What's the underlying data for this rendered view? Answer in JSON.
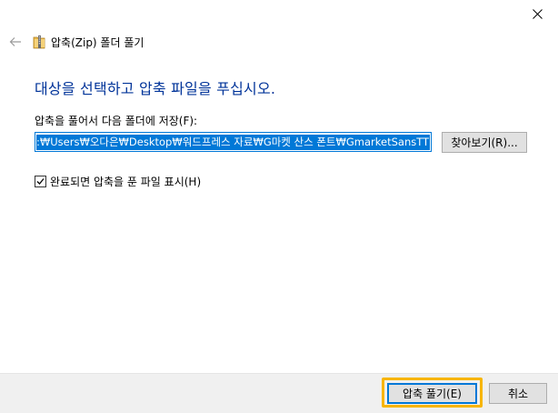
{
  "header": {
    "title": "압축(Zip) 폴더 풀기"
  },
  "main": {
    "instruction": "대상을 선택하고 압축 파일을 푸십시오.",
    "destination_label": "압축을 풀어서 다음 폴더에 저장(F):",
    "destination_path": ":₩Users₩오다은₩Desktop₩워드프레스 자료₩G마켓 산스 폰트₩GmarketSansTTF",
    "browse_label": "찾아보기(R)...",
    "show_files_label": "완료되면 압축을 푼 파일 표시(H)",
    "show_files_checked": true
  },
  "footer": {
    "extract_label": "압축 풀기(E)",
    "cancel_label": "취소"
  },
  "colors": {
    "instruction_text": "#003399",
    "selection": "#0078d7",
    "highlight": "#f7b500",
    "footer_bg": "#f0f0f0"
  },
  "icons": {
    "back": "back-arrow-icon",
    "folder": "zip-folder-icon",
    "close": "close-icon",
    "check": "checkmark-icon"
  }
}
